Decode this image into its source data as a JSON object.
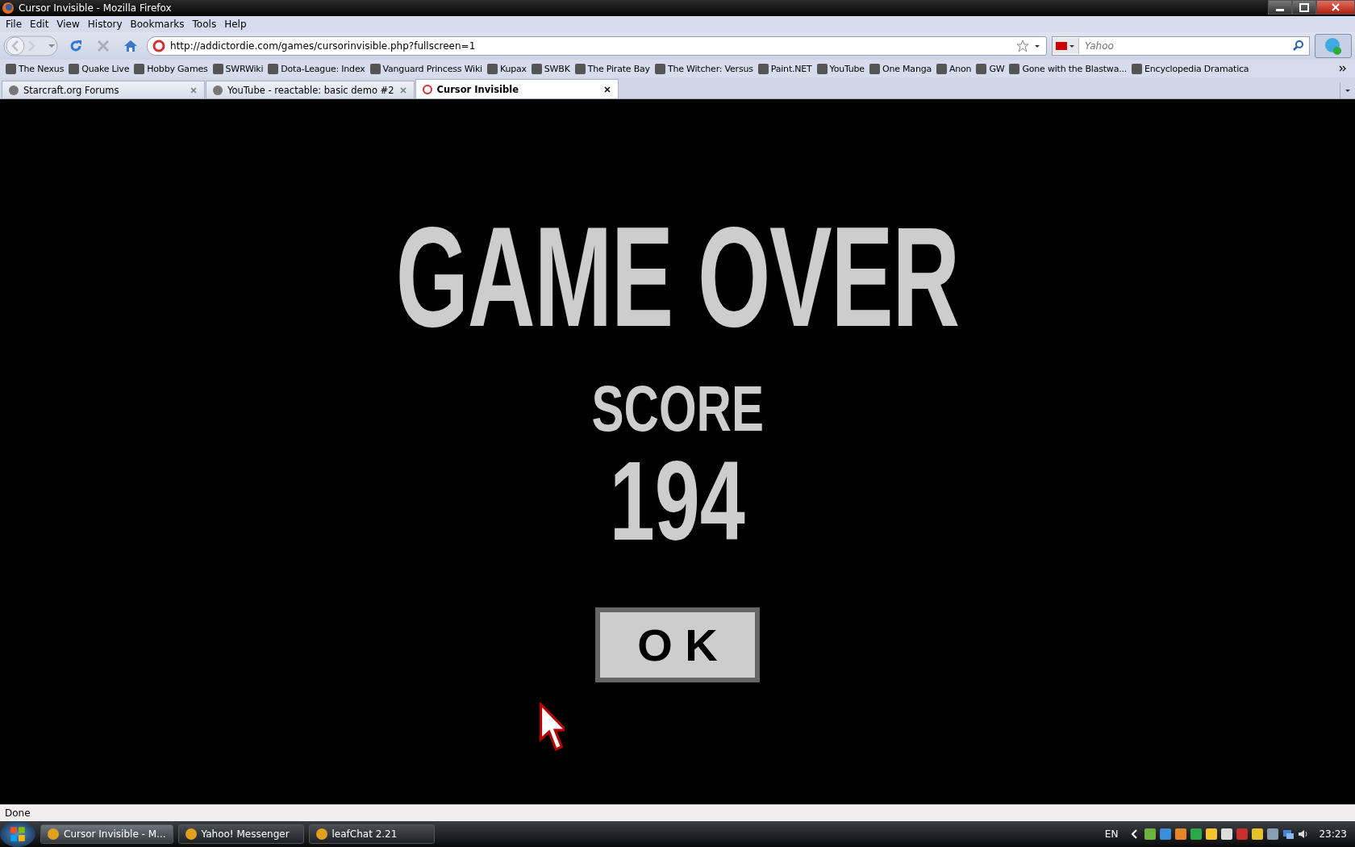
{
  "window": {
    "title": "Cursor Invisible - Mozilla Firefox"
  },
  "menu": [
    "File",
    "Edit",
    "View",
    "History",
    "Bookmarks",
    "Tools",
    "Help"
  ],
  "address": {
    "value": "http://addictordie.com/games/cursorinvisible.php?fullscreen=1"
  },
  "search": {
    "placeholder": "Yahoo"
  },
  "bookmarks": [
    "The Nexus",
    "Quake Live",
    "Hobby Games",
    "SWRWiki",
    "Dota-League: Index",
    "Vanguard Princess Wiki",
    "Kupax",
    "SWBK",
    "The Pirate Bay",
    "The Witcher: Versus",
    "Paint.NET",
    "YouTube",
    "One Manga",
    "Anon",
    "GW",
    "Gone with the Blastwa...",
    "Encyclopedia Dramatica"
  ],
  "tabs": [
    {
      "label": "Starcraft.org Forums",
      "selected": false
    },
    {
      "label": "YouTube - reactable: basic demo #2",
      "selected": false
    },
    {
      "label": "Cursor Invisible",
      "selected": true
    }
  ],
  "game": {
    "title": "GAME OVER",
    "score_label": "SCORE",
    "score": "194",
    "button": "O K"
  },
  "status_bar": "Done",
  "taskbar": {
    "items": [
      {
        "label": "Cursor Invisible - M...",
        "selected": true
      },
      {
        "label": "Yahoo! Messenger",
        "selected": false
      },
      {
        "label": "leafChat 2.21",
        "selected": false
      }
    ],
    "language": "EN",
    "clock": "23:23"
  }
}
